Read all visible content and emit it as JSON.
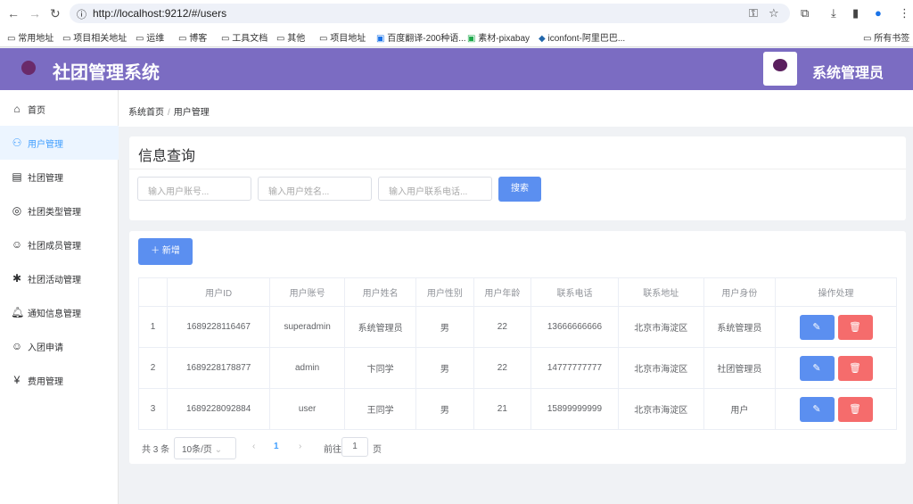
{
  "browser": {
    "url": "http://localhost:9212/#/users",
    "bookmarks": [
      "常用地址",
      "项目相关地址",
      "运维",
      "博客",
      "工具文档",
      "其他",
      "项目地址",
      "百度翻译-200种语...",
      "素材-pixabay",
      "iconfont-阿里巴巴..."
    ],
    "all_bookmarks": "所有书签"
  },
  "header": {
    "title": "社团管理系统",
    "user": "系统管理员",
    "color": "#7b6cc2"
  },
  "sidebar": {
    "items": [
      {
        "label": "首页",
        "icon": "home-icon"
      },
      {
        "label": "用户管理",
        "icon": "users-icon",
        "active": true
      },
      {
        "label": "社团管理",
        "icon": "club-icon"
      },
      {
        "label": "社团类型管理",
        "icon": "type-icon"
      },
      {
        "label": "社团成员管理",
        "icon": "member-icon"
      },
      {
        "label": "社团活动管理",
        "icon": "activity-icon"
      },
      {
        "label": "通知信息管理",
        "icon": "bell-icon"
      },
      {
        "label": "入团申请",
        "icon": "apply-icon"
      },
      {
        "label": "费用管理",
        "icon": "yen-icon"
      }
    ]
  },
  "breadcrumb": {
    "home": "系统首页",
    "sep": "/",
    "current": "用户管理"
  },
  "search": {
    "title": "信息查询",
    "account_placeholder": "输入用户账号...",
    "name_placeholder": "输入用户姓名...",
    "phone_placeholder": "输入用户联系电话...",
    "button": "搜索"
  },
  "table": {
    "add_button": "新增",
    "headers": [
      "",
      "用户ID",
      "用户账号",
      "用户姓名",
      "用户性别",
      "用户年龄",
      "联系电话",
      "联系地址",
      "用户身份",
      "操作处理"
    ],
    "rows": [
      [
        "1",
        "1689228116467",
        "superadmin",
        "系统管理员",
        "男",
        "22",
        "13666666666",
        "北京市海淀区",
        "系统管理员"
      ],
      [
        "2",
        "1689228178877",
        "admin",
        "卞同学",
        "男",
        "22",
        "14777777777",
        "北京市海淀区",
        "社团管理员"
      ],
      [
        "3",
        "1689228092884",
        "user",
        "王同学",
        "男",
        "21",
        "15899999999",
        "北京市海淀区",
        "用户"
      ]
    ]
  },
  "pagination": {
    "total": "共 3 条",
    "page_size": "10条/页",
    "current": "1",
    "goto": "前往",
    "goto_value": "1",
    "page_suffix": "页"
  }
}
